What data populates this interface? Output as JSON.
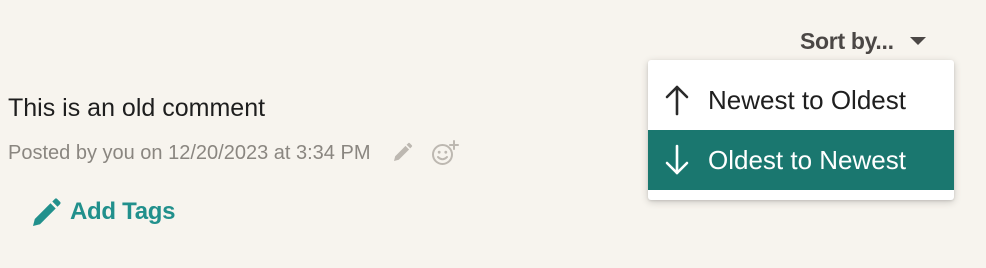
{
  "sort": {
    "label": "Sort by...",
    "options": [
      {
        "label": "Newest to Oldest",
        "icon": "arrow-up-icon",
        "selected": false
      },
      {
        "label": "Oldest to Newest",
        "icon": "arrow-down-icon",
        "selected": true
      }
    ]
  },
  "comment": {
    "text": "This is an old comment",
    "meta": "Posted by you on 12/20/2023 at 3:34 PM"
  },
  "tags": {
    "add_label": "Add Tags"
  },
  "colors": {
    "background": "#f7f4ee",
    "accent": "#1a776f",
    "tag_accent": "#21908c",
    "muted_text": "#8a8680"
  }
}
